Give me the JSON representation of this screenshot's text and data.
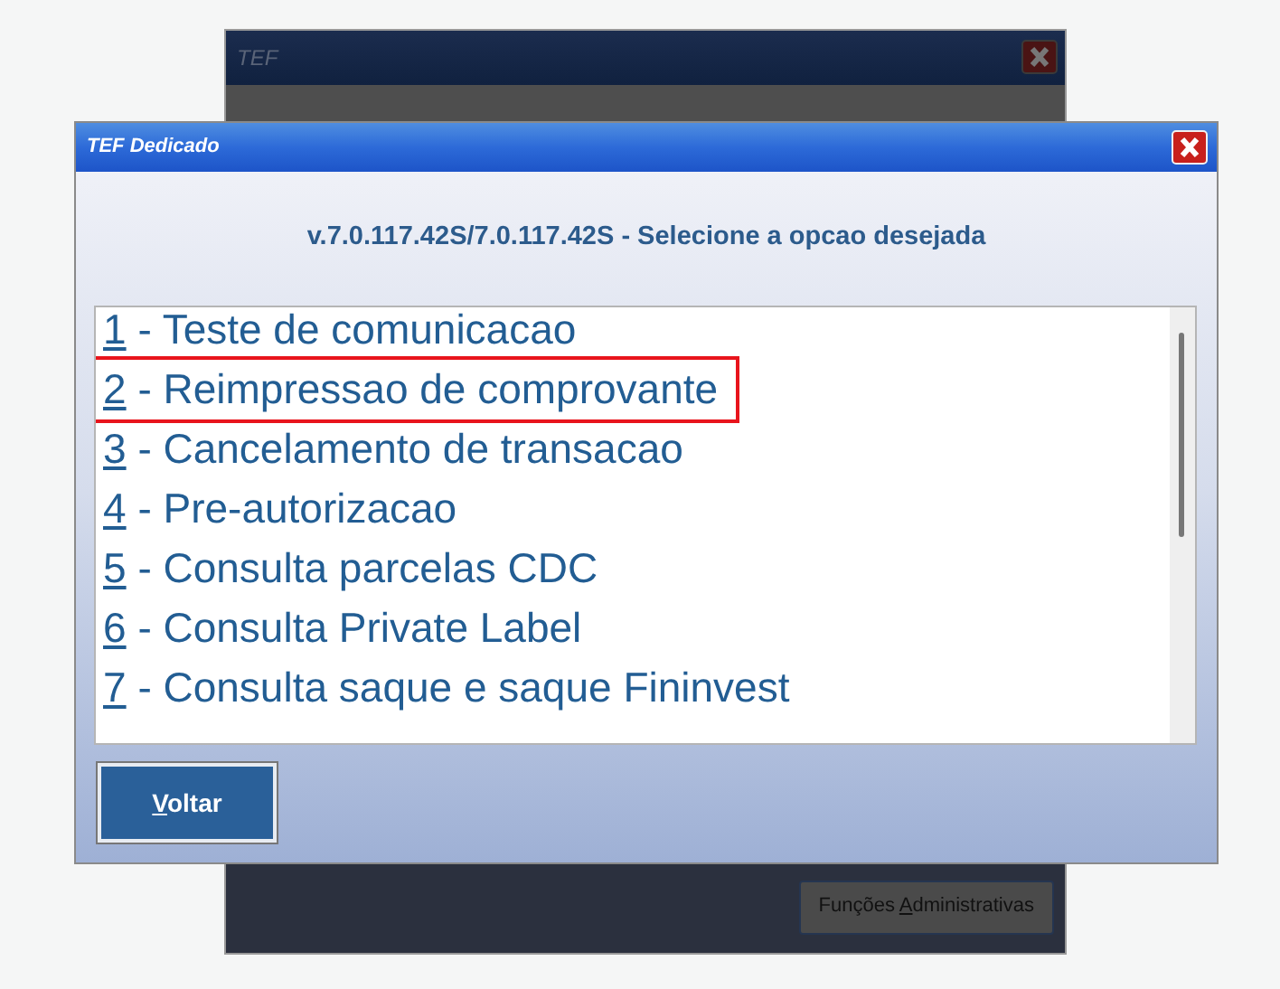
{
  "back_window": {
    "title": "TEF",
    "button": {
      "before": "Funções ",
      "accesskey": "A",
      "after": "dministrativas"
    }
  },
  "dialog": {
    "title": "TEF Dedicado",
    "heading": "v.7.0.117.42S/7.0.117.42S - Selecione a opcao desejada",
    "options": [
      {
        "number": "1",
        "text": "- Teste de comunicacao",
        "highlighted": false
      },
      {
        "number": "2",
        "text": "- Reimpressao de comprovante",
        "highlighted": true
      },
      {
        "number": "3",
        "text": "- Cancelamento de transacao",
        "highlighted": false
      },
      {
        "number": "4",
        "text": "- Pre-autorizacao",
        "highlighted": false
      },
      {
        "number": "5",
        "text": "- Consulta parcelas CDC",
        "highlighted": false
      },
      {
        "number": "6",
        "text": "- Consulta Private Label",
        "highlighted": false
      },
      {
        "number": "7",
        "text": "- Consulta saque e saque Fininvest",
        "highlighted": false
      }
    ],
    "button": {
      "accesskey": "V",
      "after": "oltar"
    }
  }
}
